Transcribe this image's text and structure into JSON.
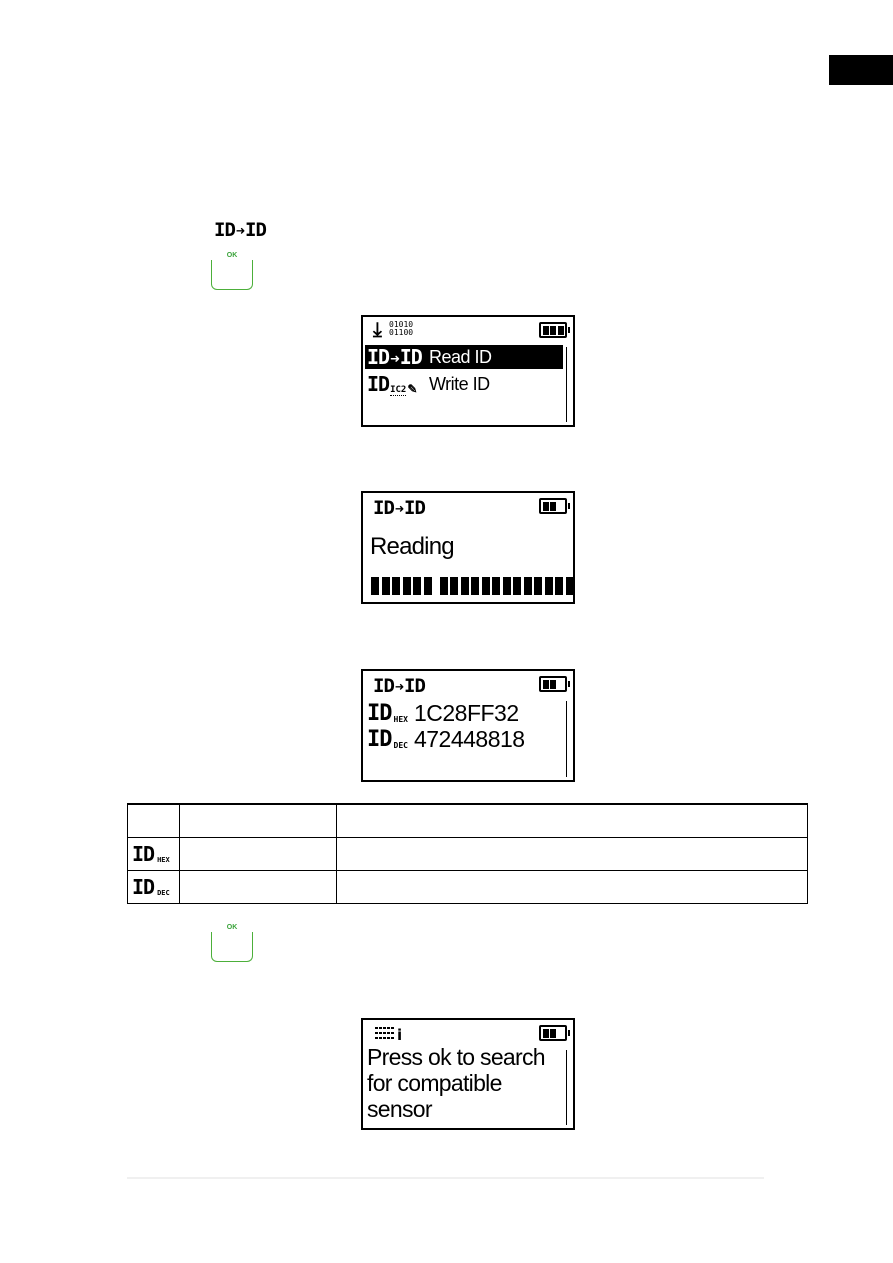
{
  "page": {
    "side_tab_color": "#000000",
    "accent_ok_color": "#4caf3a"
  },
  "step_icon": {
    "icon": "id-to-id-icon",
    "left": "ID",
    "arrow": "➜",
    "right": "ID"
  },
  "ok_buttons": [
    {
      "label": "OK",
      "icon": "ok-key-icon"
    },
    {
      "label": "OK",
      "icon": "ok-key-icon"
    }
  ],
  "screens": {
    "menu": {
      "header_icon": "download-binary-icon",
      "header_bits": [
        "01010",
        "01100"
      ],
      "battery_level": "3/3",
      "battery_cells": 3,
      "items": [
        {
          "icon": "id-to-id-icon",
          "icon_left": "ID",
          "icon_arrow": "➜",
          "icon_right": "ID",
          "label": "Read ID",
          "selected": true
        },
        {
          "icon": "id-write-icon",
          "icon_left": "ID",
          "icon_small": "IC2",
          "icon_pen": "✎",
          "label": "Write ID",
          "selected": false
        }
      ]
    },
    "reading": {
      "title_left": "ID",
      "title_arrow": "➜",
      "title_right": "ID",
      "battery_level": "2/3",
      "battery_cells": 2,
      "status": "Reading",
      "progress_segments_group1": 6,
      "progress_segments_group2": 13
    },
    "result": {
      "title_left": "ID",
      "title_arrow": "➜",
      "title_right": "ID",
      "battery_level": "2/3",
      "battery_cells": 2,
      "rows": [
        {
          "id": "ID",
          "format": "HEX",
          "value": "1C28FF32"
        },
        {
          "id": "ID",
          "format": "DEC",
          "value": "472448818"
        }
      ]
    },
    "info": {
      "header_icon": "info-list-icon",
      "header_letter": "i",
      "battery_level": "2/3",
      "battery_cells": 2,
      "message": "Press ok to search for compatible sensor",
      "lines": [
        "Press ok to search",
        "for compatible",
        "sensor"
      ]
    }
  },
  "table": {
    "header": [
      "",
      "",
      ""
    ],
    "rows": [
      {
        "icon_id": "ID",
        "icon_sub": "HEX",
        "col2": "",
        "col3": ""
      },
      {
        "icon_id": "ID",
        "icon_sub": "DEC",
        "col2": "",
        "col3": ""
      }
    ]
  }
}
